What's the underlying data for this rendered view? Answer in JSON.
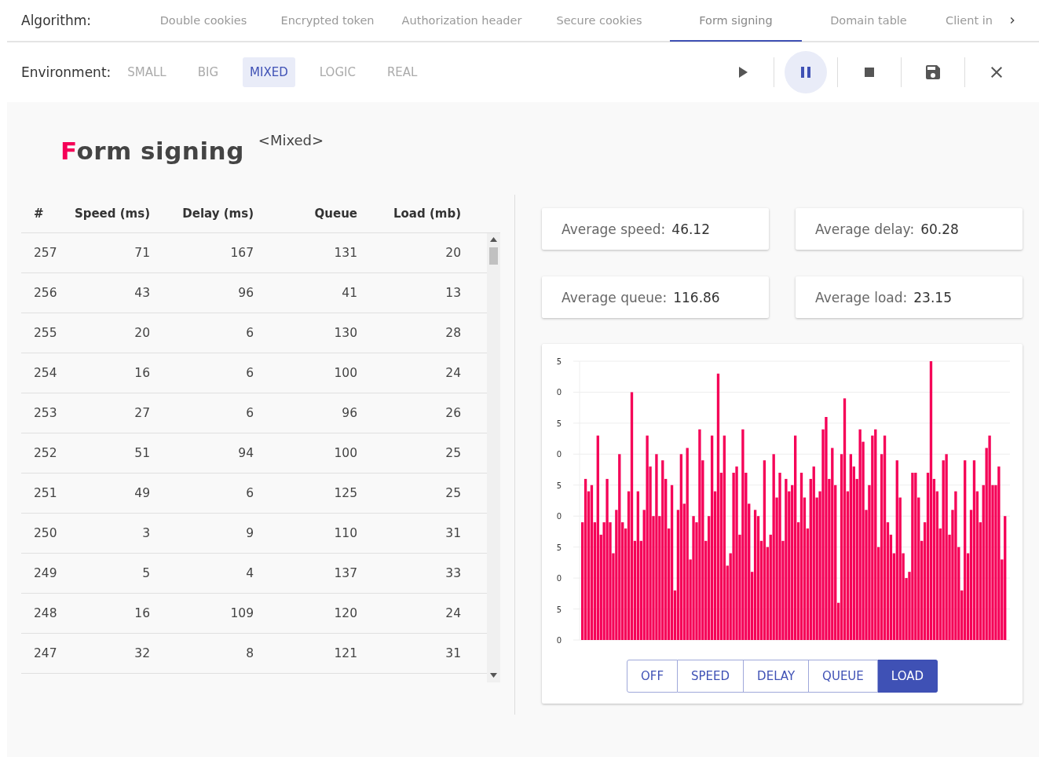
{
  "algorithm": {
    "label": "Algorithm:",
    "tabs": [
      {
        "label": "Double cookies",
        "selected": false
      },
      {
        "label": "Encrypted token",
        "selected": false
      },
      {
        "label": "Authorization header",
        "selected": false
      },
      {
        "label": "Secure cookies",
        "selected": false
      },
      {
        "label": "Form signing",
        "selected": true
      },
      {
        "label": "Domain table",
        "selected": false
      },
      {
        "label": "Client in",
        "selected": false
      }
    ]
  },
  "environment": {
    "label": "Environment:",
    "options": [
      {
        "label": "SMALL",
        "selected": false
      },
      {
        "label": "BIG",
        "selected": false
      },
      {
        "label": "MIXED",
        "selected": true
      },
      {
        "label": "LOGIC",
        "selected": false
      },
      {
        "label": "REAL",
        "selected": false
      }
    ]
  },
  "controls": [
    {
      "kind": "play",
      "selected": false
    },
    {
      "kind": "pause",
      "selected": true
    },
    {
      "kind": "stop",
      "selected": false
    },
    {
      "kind": "save",
      "selected": false
    },
    {
      "kind": "close",
      "selected": false
    }
  ],
  "title": "Form signing",
  "subtitle": "<Mixed>",
  "table": {
    "columns": [
      "#",
      "Speed (ms)",
      "Delay (ms)",
      "Queue",
      "Load (mb)"
    ],
    "rows": [
      [
        "257",
        "71",
        "167",
        "131",
        "20"
      ],
      [
        "256",
        "43",
        "96",
        "41",
        "13"
      ],
      [
        "255",
        "20",
        "6",
        "130",
        "28"
      ],
      [
        "254",
        "16",
        "6",
        "100",
        "24"
      ],
      [
        "253",
        "27",
        "6",
        "96",
        "26"
      ],
      [
        "252",
        "51",
        "94",
        "100",
        "25"
      ],
      [
        "251",
        "49",
        "6",
        "125",
        "25"
      ],
      [
        "250",
        "3",
        "9",
        "110",
        "31"
      ],
      [
        "249",
        "5",
        "4",
        "137",
        "33"
      ],
      [
        "248",
        "16",
        "109",
        "120",
        "24"
      ],
      [
        "247",
        "32",
        "8",
        "121",
        "31"
      ]
    ]
  },
  "stats": [
    {
      "label": "Average speed:",
      "value": "46.12"
    },
    {
      "label": "Average delay:",
      "value": "60.28"
    },
    {
      "label": "Average queue:",
      "value": "116.86"
    },
    {
      "label": "Average load:",
      "value": "23.15"
    }
  ],
  "chart": {
    "y_axis_labels": [
      "5",
      "0",
      "5",
      "0",
      "5",
      "0",
      "5",
      "0",
      "5",
      "0"
    ],
    "toggles": [
      {
        "label": "OFF",
        "selected": false
      },
      {
        "label": "SPEED",
        "selected": false
      },
      {
        "label": "DELAY",
        "selected": false
      },
      {
        "label": "QUEUE",
        "selected": false
      },
      {
        "label": "LOAD",
        "selected": true
      }
    ]
  }
}
